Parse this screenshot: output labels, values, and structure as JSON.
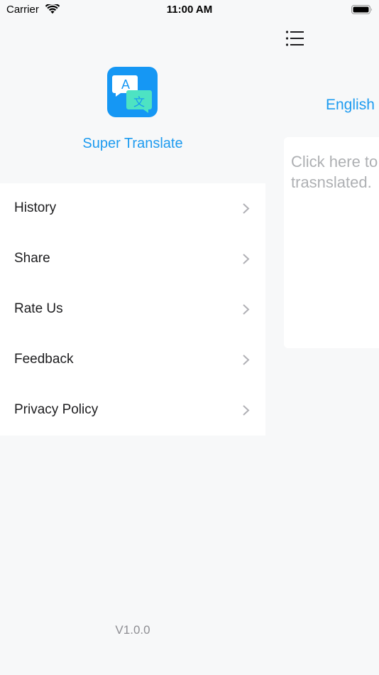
{
  "status_bar": {
    "carrier": "Carrier",
    "time": "11:00 AM"
  },
  "drawer": {
    "app_name": "Super Translate",
    "logo": {
      "icon": "translate-icon",
      "glyph_latin": "A",
      "glyph_cjk": "文",
      "background_color": "#1597f4",
      "bubble_left_color": "#ffffff",
      "bubble_right_color": "#4de3c3"
    },
    "menu_items": [
      {
        "label": "History",
        "icon": "chevron-right-icon"
      },
      {
        "label": "Share",
        "icon": "chevron-right-icon"
      },
      {
        "label": "Rate Us",
        "icon": "chevron-right-icon"
      },
      {
        "label": "Feedback",
        "icon": "chevron-right-icon"
      },
      {
        "label": "Privacy Policy",
        "icon": "chevron-right-icon"
      }
    ],
    "version": "V1.0.0"
  },
  "main": {
    "menu_icon": "list-menu-icon",
    "source_language": "English",
    "input_placeholder": "Click here to enter text to be trasnslated."
  },
  "colors": {
    "accent": "#1d9bf0",
    "background": "#f7f8f9",
    "surface": "#ffffff",
    "placeholder": "#aeb0b3",
    "secondary_text": "#8e8e93"
  }
}
